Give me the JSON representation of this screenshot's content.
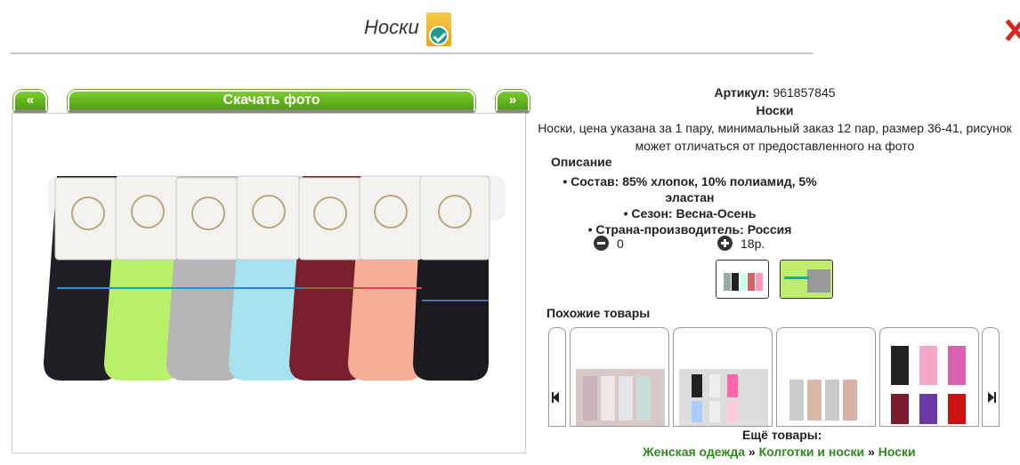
{
  "page": {
    "title": "Носки"
  },
  "gallery": {
    "prev_label": "«",
    "next_label": "»",
    "download_label": "Скачать фото"
  },
  "product": {
    "sku_label": "Артикул:",
    "sku": "961857845",
    "name": "Носки",
    "description": "Носки, цена указана за 1 пару, минимальный заказ 12 пар, размер 36-41, рисунок может отличаться от предоставленного на фото",
    "desc_heading": "Описание",
    "specs": [
      "Состав: 85% хлопок, 10% полиамид, 5% эластан",
      "Сезон: Весна-Осень",
      "Страна-производитель: Россия"
    ]
  },
  "order": {
    "quantity": "0",
    "price": "18р."
  },
  "similar": {
    "heading": "Похожие товары"
  },
  "more": {
    "heading": "Ещё товары:",
    "breadcrumbs": [
      "Женская одежда",
      "Колготки и носки",
      "Носки"
    ],
    "separator": "»"
  },
  "colors": {
    "accent_green": "#5aad17",
    "link_green": "#2a8a1a"
  }
}
